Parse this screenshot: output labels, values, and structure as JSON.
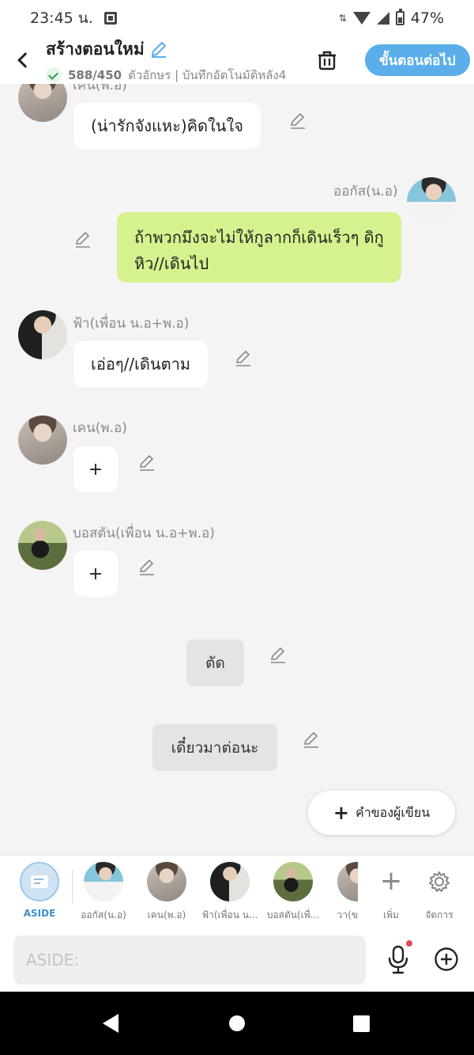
{
  "status": {
    "time": "23:45 น.",
    "battery": "47%"
  },
  "header": {
    "title": "สร้างตอนใหม่",
    "count": "588/450",
    "autosave": "ตัวอักษร | บันทึกอัตโนมัติหลัง4",
    "next_label": "ขั้นตอนต่อไป"
  },
  "messages": [
    {
      "name": "เคน(พ.อ)",
      "text": "(น่ารักจังแหะ)คิดในใจ"
    },
    {
      "name": "ออกัส(น.อ)",
      "text": "ถ้าพวกมึงจะไม่ให้กูลากก็เดินเร็วๆ ดิกูหิว//เดินไป"
    },
    {
      "name": "ฟ้า(เพื่อน น.อ+พ.อ)",
      "text": "เอ่อๆ//เดินตาม"
    },
    {
      "name": "เคน(พ.อ)",
      "text": "+"
    },
    {
      "name": "บอสตัน(เพื่อน น.อ+พ.อ)",
      "text": "+"
    }
  ],
  "system": {
    "cut": "ตัด",
    "later": "เดี๋ยวมาต่อนะ"
  },
  "narration_label": "คำของผู้เขียน",
  "characters": [
    {
      "label": "ASIDE"
    },
    {
      "label": "ออกัส(น.อ)"
    },
    {
      "label": "เคน(พ.อ)"
    },
    {
      "label": "ฟ้า(เพื่อน น..."
    },
    {
      "label": "บอสตัน(เพื่..."
    },
    {
      "label": "วา(ข"
    }
  ],
  "char_actions": {
    "add": "เพิ่ม",
    "manage": "จัดการ"
  },
  "input": {
    "placeholder": "ASIDE:"
  },
  "colors": {
    "accent": "#5aaeea",
    "green_bubble": "#d6f28e",
    "background": "#f4f4f4"
  }
}
